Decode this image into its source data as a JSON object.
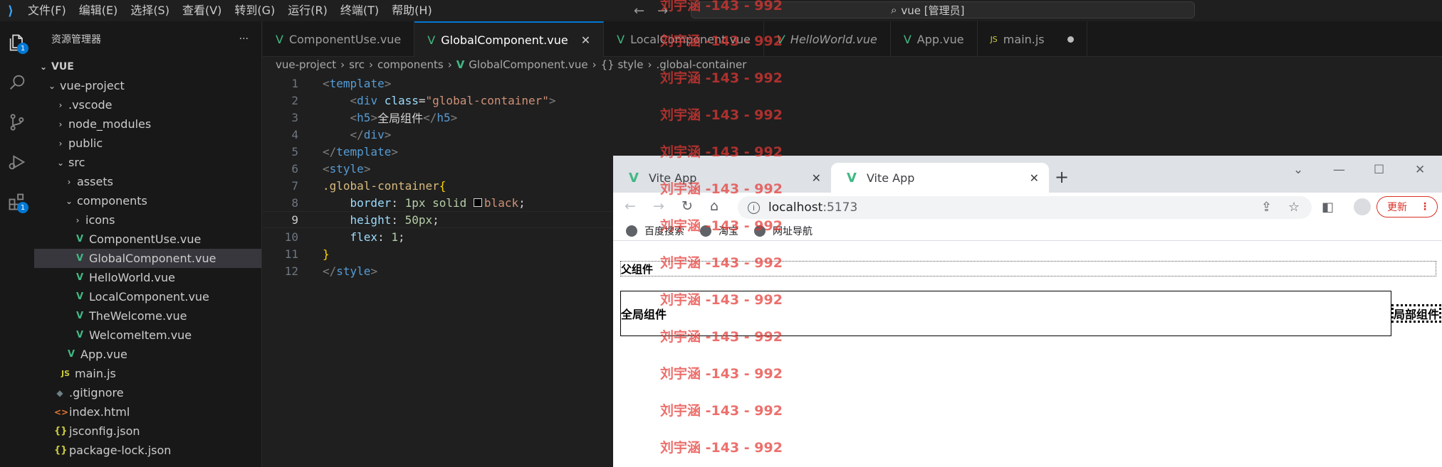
{
  "menu": [
    "文件(F)",
    "编辑(E)",
    "选择(S)",
    "查看(V)",
    "转到(G)",
    "运行(R)",
    "终端(T)",
    "帮助(H)"
  ],
  "search": {
    "label": "vue [管理员]"
  },
  "activity_badges": {
    "explorer": "1",
    "extensions": "1"
  },
  "sidebar": {
    "title": "资源管理器",
    "root": "VUE",
    "items": [
      "vue-project",
      ".vscode",
      "node_modules",
      "public",
      "src",
      "assets",
      "components",
      "icons",
      "ComponentUse.vue",
      "GlobalComponent.vue",
      "HelloWorld.vue",
      "LocalComponent.vue",
      "TheWelcome.vue",
      "WelcomeItem.vue",
      "App.vue",
      "main.js",
      ".gitignore",
      "index.html",
      "jsconfig.json",
      "package-lock.json"
    ]
  },
  "tabs": [
    "ComponentUse.vue",
    "GlobalComponent.vue",
    "LocalComponent.vue",
    "HelloWorld.vue",
    "App.vue",
    "main.js"
  ],
  "breadcrumb": [
    "vue-project",
    "src",
    "components",
    "GlobalComponent.vue",
    "{} style",
    ".global-container"
  ],
  "code": {
    "line_numbers": [
      "1",
      "2",
      "3",
      "4",
      "5",
      "6",
      "7",
      "8",
      "9",
      "10",
      "11",
      "12"
    ],
    "template_tag": "template",
    "div_tag": "div",
    "class_attr": "class",
    "class_value": "\"global-container\"",
    "h5_tag": "h5",
    "h5_text": "全局组件",
    "style_tag": "style",
    "selector": ".global-container",
    "border_prop": "border",
    "border_value": "1px solid ",
    "border_color": "black",
    "height_prop": "height",
    "height_value": "50px",
    "flex_prop": "flex",
    "flex_value": "1"
  },
  "browser": {
    "tabs": [
      "Vite App",
      "Vite App"
    ],
    "url_host": "localhost",
    "url_port": ":5173",
    "update_label": "更新",
    "bookmarks": [
      "百度搜索",
      "淘宝",
      "网址导航"
    ],
    "page": {
      "parent_label": "父组件",
      "global_label": "全局组件",
      "local_label": "局部组件"
    }
  },
  "watermark": {
    "text": "刘宇涵 -143 - 992",
    "color": "#e53935"
  },
  "colors": {
    "accent": "#0078d4",
    "vue_green": "#41b883"
  }
}
